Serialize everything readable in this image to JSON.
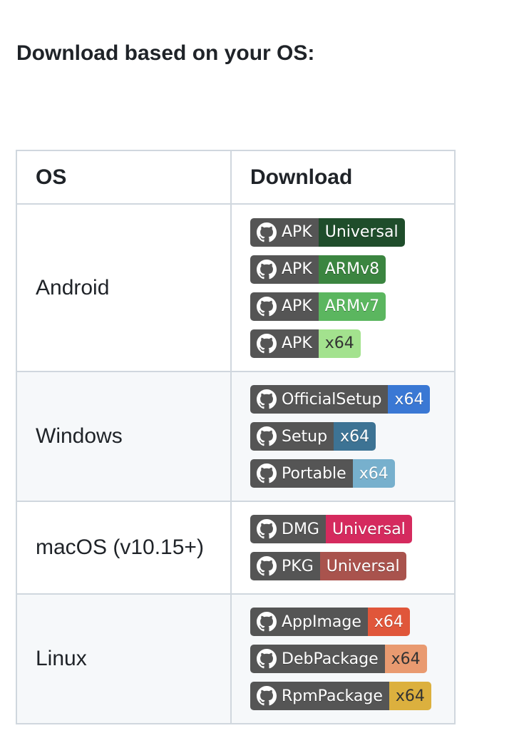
{
  "heading": "Download based on your OS:",
  "table": {
    "headers": [
      "OS",
      "Download"
    ],
    "rows": [
      {
        "os": "Android",
        "badges": [
          {
            "label": "APK",
            "message": "Universal",
            "color": "#1f4d2b",
            "dark_text": false
          },
          {
            "label": "APK",
            "message": "ARMv8",
            "color": "#3b8540",
            "dark_text": false
          },
          {
            "label": "APK",
            "message": "ARMv7",
            "color": "#5bb65f",
            "dark_text": false
          },
          {
            "label": "APK",
            "message": "x64",
            "color": "#a3e28e",
            "dark_text": true
          }
        ]
      },
      {
        "os": "Windows",
        "badges": [
          {
            "label": "OfficialSetup",
            "message": "x64",
            "color": "#3a78d4",
            "dark_text": false
          },
          {
            "label": "Setup",
            "message": "x64",
            "color": "#3d7394",
            "dark_text": false
          },
          {
            "label": "Portable",
            "message": "x64",
            "color": "#77b0cd",
            "dark_text": false
          }
        ]
      },
      {
        "os": "macOS (v10.15+)",
        "badges": [
          {
            "label": "DMG",
            "message": "Universal",
            "color": "#d52a5e",
            "dark_text": false
          },
          {
            "label": "PKG",
            "message": "Universal",
            "color": "#a9534d",
            "dark_text": false
          }
        ]
      },
      {
        "os": "Linux",
        "badges": [
          {
            "label": "AppImage",
            "message": "x64",
            "color": "#e0563a",
            "dark_text": false
          },
          {
            "label": "DebPackage",
            "message": "x64",
            "color": "#e99a70",
            "dark_text": true
          },
          {
            "label": "RpmPackage",
            "message": "x64",
            "color": "#dcb03e",
            "dark_text": true
          }
        ]
      }
    ]
  },
  "badge_icon": "github-icon",
  "colors": {
    "border": "#d0d7de",
    "alt_row_bg": "#f6f8fa",
    "badge_label_bg": "#555555",
    "text": "#1f2328"
  }
}
